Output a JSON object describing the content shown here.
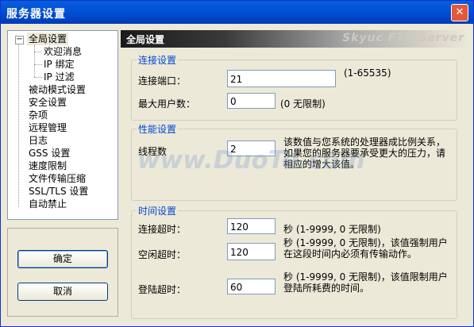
{
  "window": {
    "title": "服务器设置",
    "close_label": "✕"
  },
  "tree": {
    "collapse_label": "−",
    "items": [
      {
        "label": "全局设置"
      },
      {
        "label": "欢迎消息"
      },
      {
        "label": "IP 绑定"
      },
      {
        "label": "IP 过滤"
      },
      {
        "label": "被动模式设置"
      },
      {
        "label": "安全设置"
      },
      {
        "label": "杂项"
      },
      {
        "label": "远程管理"
      },
      {
        "label": "日志"
      },
      {
        "label": "GSS 设置"
      },
      {
        "label": "速度限制"
      },
      {
        "label": "文件传输压缩"
      },
      {
        "label": "SSL/TLS 设置"
      },
      {
        "label": "自动禁止"
      }
    ]
  },
  "buttons": {
    "ok": "确定",
    "cancel": "取消"
  },
  "header": {
    "title": "全局设置",
    "brand": "Skyuc FTP Server"
  },
  "connection": {
    "group_label": "连接设置",
    "port_label": "连接端口：",
    "port_value": "21",
    "port_range": "(1-65535)",
    "max_users_label": "最大用户数：",
    "max_users_value": "0",
    "max_users_note": "(0  无限制)"
  },
  "performance": {
    "group_label": "性能设置",
    "threads_label": "线程数",
    "threads_value": "2",
    "threads_note": "该数值与您系统的处理器成比例关系，如果您的服务器要承受更大的压力，请相应的增大该值。"
  },
  "timeout": {
    "group_label": "时间设置",
    "conn_label": "连接超时：",
    "conn_value": "120",
    "conn_note": "秒 (1-9999, 0 无限制)",
    "idle_label": "空闲超时：",
    "idle_value": "120",
    "idle_note": "秒 (1-9999, 0 无限制)，该值强制用户在这段时间内必须有传输动作。",
    "login_label": "登陆超时：",
    "login_value": "60",
    "login_note": "秒 (1-9999, 0 无限制)，该值限制用户登陆所耗费的时间。"
  },
  "watermark": {
    "text": "www.DuoTe.com"
  }
}
